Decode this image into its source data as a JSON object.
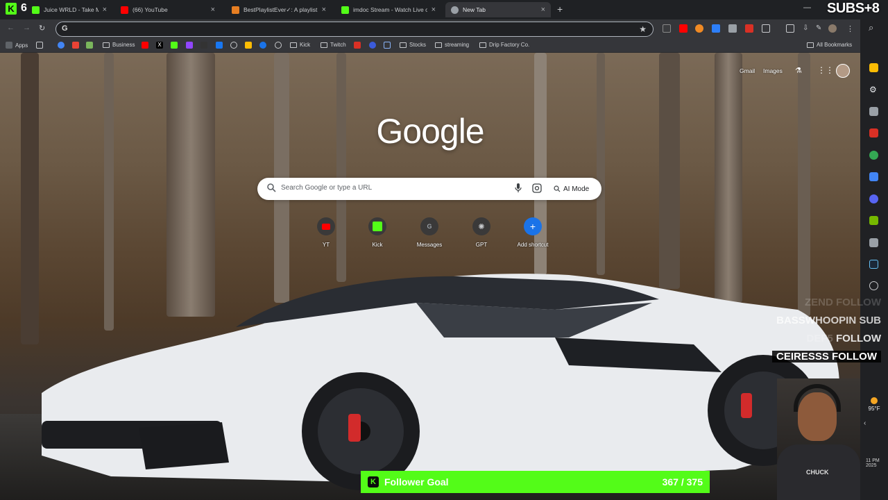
{
  "tabs": [
    {
      "title": "Juice WRLD - Take My Soul",
      "icon_color": "#53fc18",
      "active": false
    },
    {
      "title": "(66) YouTube",
      "icon_color": "#ff0000",
      "active": false
    },
    {
      "title": "BestPlaylistEver✓: A playlist by",
      "icon_color": "#e67e22",
      "active": false
    },
    {
      "title": "imdoc Stream - Watch Live on",
      "icon_color": "#53fc18",
      "active": false
    },
    {
      "title": "New Tab",
      "icon_color": "#9aa0a6",
      "active": true
    }
  ],
  "tab_count_badge": "6",
  "omnibox": {
    "value": "",
    "g_label": "G"
  },
  "bookmarks": {
    "apps": "Apps",
    "business": "Business",
    "kick": "Kick",
    "twitch": "Twitch",
    "stocks": "Stocks",
    "streaming": "streaming",
    "drip": "Drip Factory Co.",
    "all": "All Bookmarks"
  },
  "ntp": {
    "gmail": "Gmail",
    "images": "Images",
    "logo": "Google",
    "search_placeholder": "Search Google or type a URL",
    "ai_mode": "AI Mode"
  },
  "shortcuts": [
    {
      "label": "YT",
      "icon": "youtube-icon"
    },
    {
      "label": "Kick",
      "icon": "kick-icon"
    },
    {
      "label": "Messages",
      "icon": "messages-icon"
    },
    {
      "label": "GPT",
      "icon": "chatgpt-icon"
    },
    {
      "label": "Add shortcut",
      "icon": "plus-icon"
    }
  ],
  "stream": {
    "subs_badge": "SUBS+8",
    "alerts": [
      {
        "name": "ZEND",
        "action": "FOLLOW"
      },
      {
        "name": "BASSWHOOPIN",
        "action": "SUB"
      },
      {
        "name": "DEF5",
        "action": "FOLLOW"
      },
      {
        "name": "CEIRESSS",
        "action": "FOLLOW"
      }
    ],
    "follower_goal_label": "Follower Goal",
    "follower_goal_count": "367 / 375",
    "follower_goal_progress": 0.979,
    "webcam_shirt_text": "CHUCK"
  },
  "taskbar": {
    "temp": "95°F",
    "time": "11 PM",
    "year": "2025"
  },
  "colors": {
    "kick_green": "#53fc18",
    "chrome_dark": "#35363a",
    "tabstrip": "#1f2124"
  }
}
